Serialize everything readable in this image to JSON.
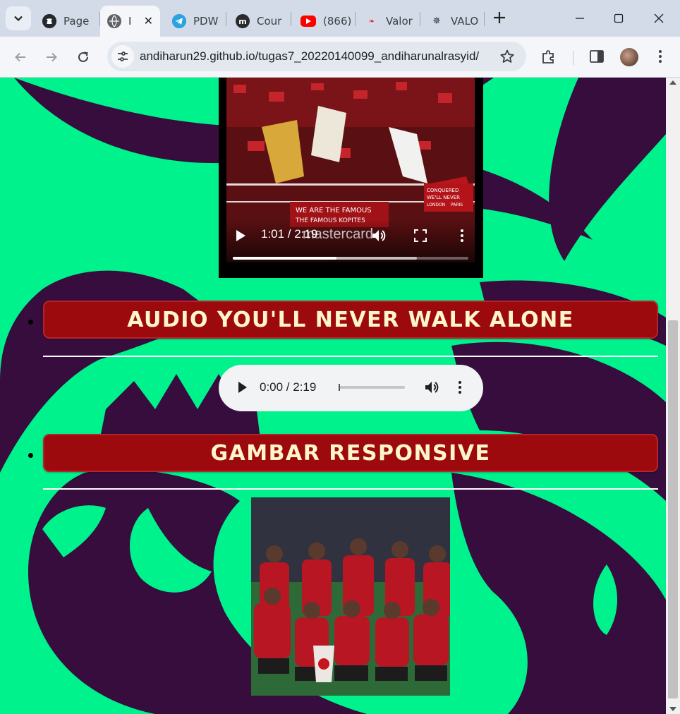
{
  "browser": {
    "tabs": [
      {
        "label": "Page",
        "favicon": "github-icon",
        "active": false
      },
      {
        "label": "I",
        "favicon": "globe-icon",
        "active": true
      },
      {
        "label": "PDW",
        "favicon": "telegram-icon",
        "active": false
      },
      {
        "label": "Cour",
        "favicon": "coursera-icon",
        "active": false
      },
      {
        "label": "(866)",
        "favicon": "youtube-icon",
        "active": false
      },
      {
        "label": "Valor",
        "favicon": "valorant-news-icon",
        "active": false
      },
      {
        "label": "VALO",
        "favicon": "valorant-icon",
        "active": false
      }
    ],
    "url": "andiharun29.github.io/tugas7_20220140099_andiharunalrasyid/"
  },
  "page": {
    "video": {
      "time": "1:01 / 2:19",
      "progress": 0.44,
      "buffered": 0.78,
      "crowd_texts": [
        "WE ARE THE FAMOUS",
        "THE FAMOUS KOPITES",
        "mastercard",
        "CONQUERED",
        "WE'LL NEVER",
        "LONDON",
        "PARIS"
      ]
    },
    "sections": [
      {
        "title": "AUDIO YOU'LL NEVER WALK ALONE"
      },
      {
        "title": "GAMBAR RESPONSIVE"
      }
    ],
    "audio": {
      "time": "0:00 / 2:19",
      "progress": 0
    }
  },
  "colors": {
    "page_background": "#00f28d",
    "background_logo": "#370d3d",
    "heading_background": "#9c0a0d",
    "heading_text": "#fff6c9",
    "tabstrip": "#d3dbe8",
    "toolbar": "#f4f6fa"
  }
}
